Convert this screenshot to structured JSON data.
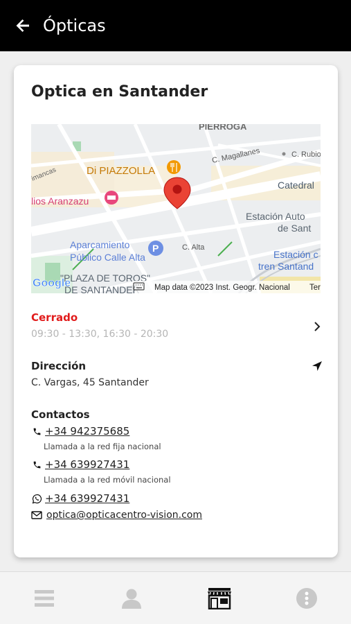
{
  "header": {
    "title": "Ópticas",
    "back_icon": "arrow-left-icon"
  },
  "store": {
    "name": "Optica en Santander",
    "status": "Cerrado",
    "hours": "09:30 - 13:30, 16:30 - 20:30",
    "address_label": "Dirección",
    "address": "C. Vargas, 45 Santander",
    "contacts_label": "Contactos",
    "phone1": "+34 942375685",
    "phone1_note": "Llamada a la red fija nacional",
    "phone2": "+34 639927431",
    "phone2_note": "Llamada a la red móvil nacional",
    "whatsapp": "+34 639927431",
    "email": "optica@opticacentro-vision.com"
  },
  "map": {
    "labels": {
      "top_area": "PIERROGA",
      "calle_magallanes": "C. Magallanes",
      "calle_rubio": "C. Rubio",
      "restaurant": "Di PIAZZOLLA",
      "catedral": "Catedral",
      "hotel": "lios Aranzazu",
      "simancas": "imancas",
      "estacion_auto_1": "Estación Auto",
      "estacion_auto_2": "de Sant",
      "parking_1": "Aparcamiento",
      "parking_2": "Público Calle Alta",
      "calle_alta": "C. Alta",
      "estacion_tren_1": "Estación c",
      "estacion_tren_2": "tren Santand",
      "plaza_1": "\"PLAZA DE TOROS\"",
      "plaza_2": "DE SANTANDER",
      "google": "Google",
      "attribution": "Map data ©2023 Inst. Geogr. Nacional",
      "terms": "Ter"
    },
    "colors": {
      "pin": "#ea4335",
      "restaurant": "#f29900",
      "hotel": "#e8477c",
      "parking": "#6d8fe3",
      "transit": "#4773c9"
    }
  },
  "colors": {
    "closed": "#e11b1b",
    "header_bg": "#000000"
  },
  "nav": {
    "items": [
      "menu-icon",
      "user-icon",
      "store-icon",
      "info-icon"
    ],
    "active": "store-icon"
  }
}
